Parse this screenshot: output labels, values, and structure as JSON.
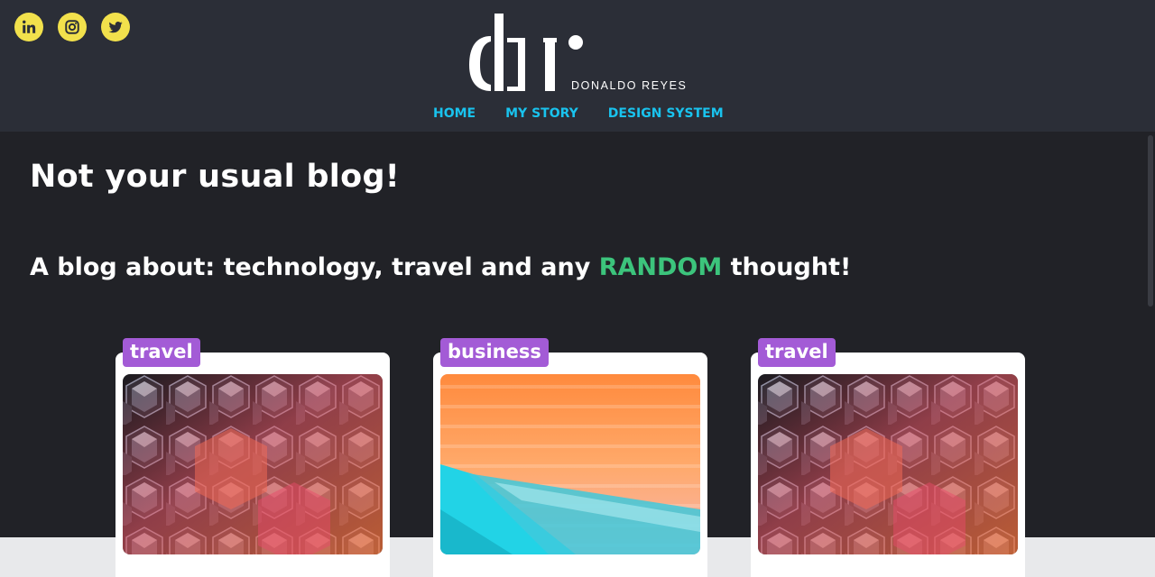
{
  "social": [
    {
      "name": "LinkedIn",
      "icon": "linkedin-icon"
    },
    {
      "name": "Instagram",
      "icon": "instagram-icon"
    },
    {
      "name": "Twitter",
      "icon": "twitter-icon"
    }
  ],
  "brand": {
    "mark": "dr",
    "name": "DONALDO REYES"
  },
  "nav": {
    "items": [
      "HOME",
      "MY STORY",
      "DESIGN SYSTEM"
    ]
  },
  "hero": {
    "title": "Not your usual blog!",
    "subtitle_before": "A blog about: technology, travel and any ",
    "subtitle_accent": "RANDOM",
    "subtitle_after": " thought!"
  },
  "posts": [
    {
      "tag": "travel",
      "image": "hexagon-mosaic-image"
    },
    {
      "tag": "business",
      "image": "orange-cyan-stripes-image"
    },
    {
      "tag": "travel",
      "image": "hexagon-mosaic-image"
    }
  ],
  "colors": {
    "header_bg": "#2b2e37",
    "hero_bg": "#212227",
    "social_bg": "#f2e14c",
    "nav_link": "#19c3ee",
    "accent_green": "#3cc47c",
    "tag_purple": "#a35bd6",
    "page_bg": "#e8e9eb"
  }
}
